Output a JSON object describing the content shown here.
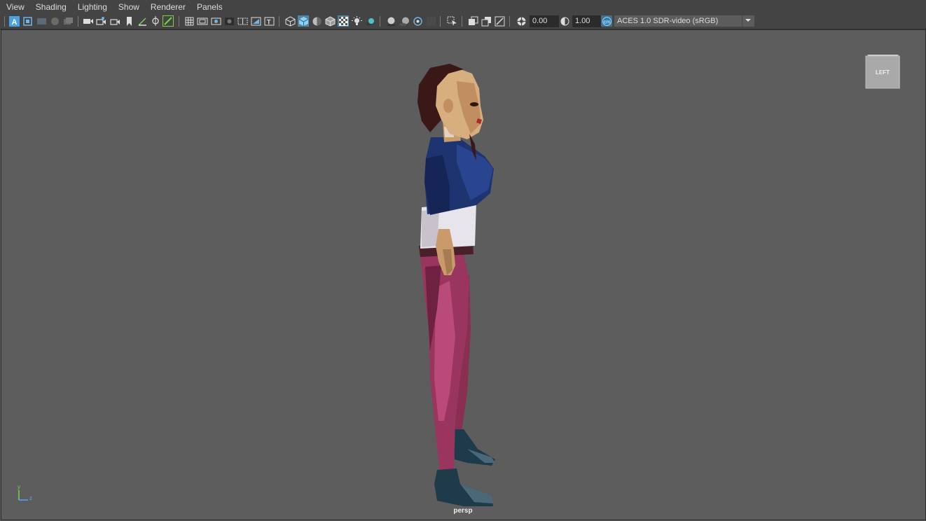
{
  "menubar": {
    "items": [
      {
        "label": "View"
      },
      {
        "label": "Shading"
      },
      {
        "label": "Lighting"
      },
      {
        "label": "Show"
      },
      {
        "label": "Renderer"
      },
      {
        "label": "Panels"
      }
    ]
  },
  "toolbar": {
    "exposure_value": "0.00",
    "gamma_value": "1.00",
    "color_space": "ACES 1.0 SDR-video (sRGB)",
    "icons": [
      "select-camera-icon",
      "camera-attributes-icon",
      "bookmarks-icon",
      "image-plane-icon",
      "grid-icon",
      "film-gate-icon",
      "resolution-gate-icon",
      "gate-mask-icon",
      "field-chart-icon",
      "safe-action-icon",
      "safe-title-icon",
      "wireframe-icon",
      "smooth-shade-icon",
      "default-material-icon",
      "xray-icon",
      "lights-icon",
      "shadows-icon",
      "isolate-select-icon",
      "xray-joints-icon",
      "exposure-icon",
      "gamma-icon",
      "color-management-icon"
    ]
  },
  "viewport": {
    "camera_name": "persp",
    "viewcube_label": "LEFT",
    "axis_labels": {
      "y": "y",
      "z": "z"
    }
  },
  "colors": {
    "background": "#5d5d5d",
    "toolbar": "#444444",
    "accent_blue": "#5285a6",
    "active_green": "#7ad14a",
    "axis_y": "#7ad14a",
    "axis_z": "#5aa0ff"
  }
}
